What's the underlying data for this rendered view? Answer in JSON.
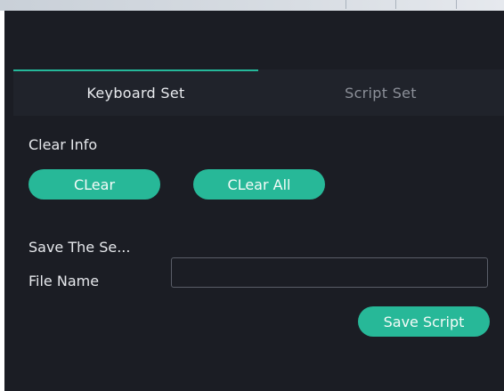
{
  "tabs": [
    {
      "label": "Keyboard Set",
      "active": true
    },
    {
      "label": "Script Set",
      "active": false
    }
  ],
  "clear_info": {
    "title": "Clear Info",
    "clear_button": "CLear",
    "clear_all_button": "CLear All"
  },
  "save_section": {
    "title": "Save The Se...",
    "file_name_label": "File Name",
    "file_name_value": "",
    "save_button": "Save Script"
  },
  "colors": {
    "accent": "#27b898",
    "background": "#1b1d24",
    "tab_bar": "#20232b"
  }
}
